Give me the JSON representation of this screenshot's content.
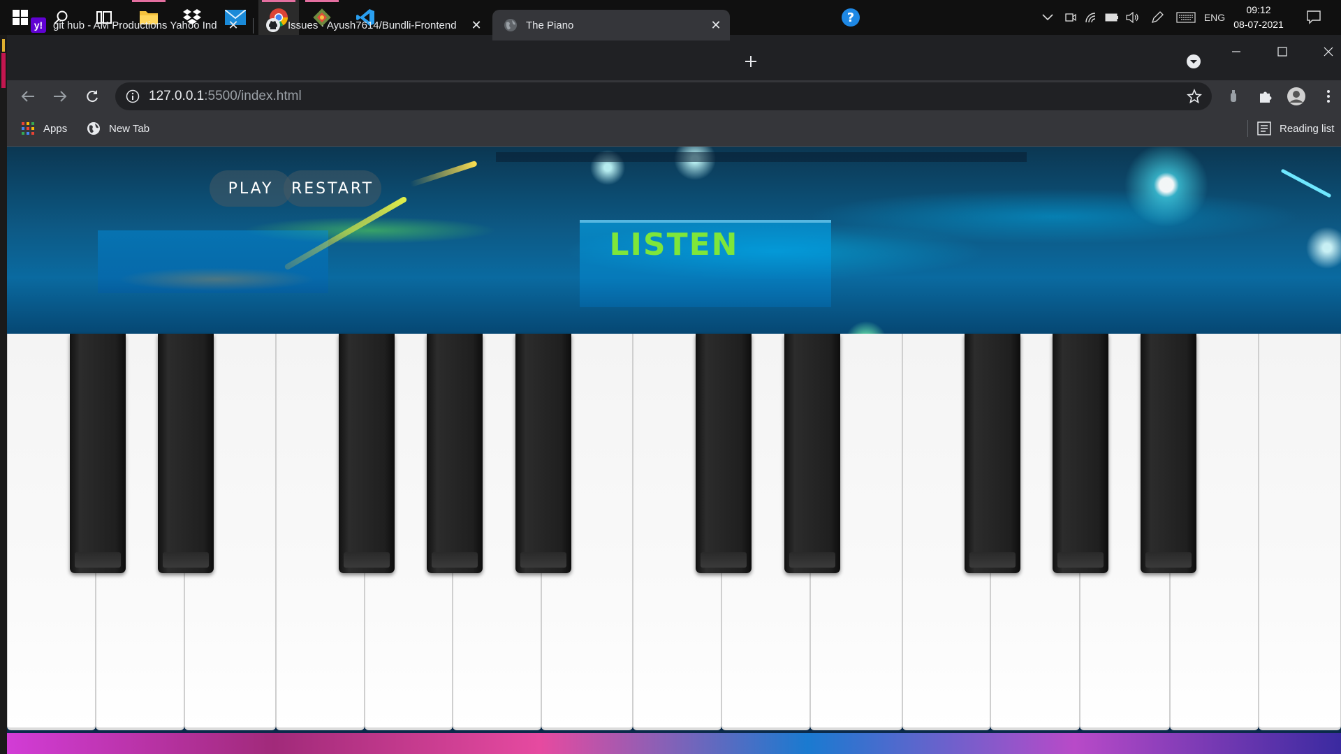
{
  "taskbar": {
    "apps": [
      "start-icon",
      "search-icon",
      "task-view-icon",
      "file-explorer-icon",
      "dropbox-icon",
      "mail-icon",
      "chrome-icon",
      "git-icon",
      "vscode-icon"
    ],
    "language": "ENG",
    "time": "09:12",
    "date": "08-07-2021"
  },
  "browser": {
    "tabs": [
      {
        "title": "git hub - AM Productions Yahoo Ind",
        "icon": "yahoo-icon"
      },
      {
        "title": "Issues · Ayush7614/Bundli-Frontend",
        "icon": "github-icon"
      },
      {
        "title": "The Piano",
        "icon": "globe-icon"
      }
    ],
    "url_host": "127.0.0.1",
    "url_path": ":5500/index.html",
    "bookmarks": {
      "apps": "Apps",
      "new_tab": "New Tab",
      "reading_list": "Reading list"
    }
  },
  "page": {
    "play_label": "PLAY",
    "restart_label": "RESTART",
    "listen_label": "LISTEN",
    "white_keys": 15,
    "black_keys": 10
  },
  "colors": {
    "listen_text": "#7ee63a",
    "taskbar_bg": "#101010",
    "chrome_bg": "#202124"
  }
}
